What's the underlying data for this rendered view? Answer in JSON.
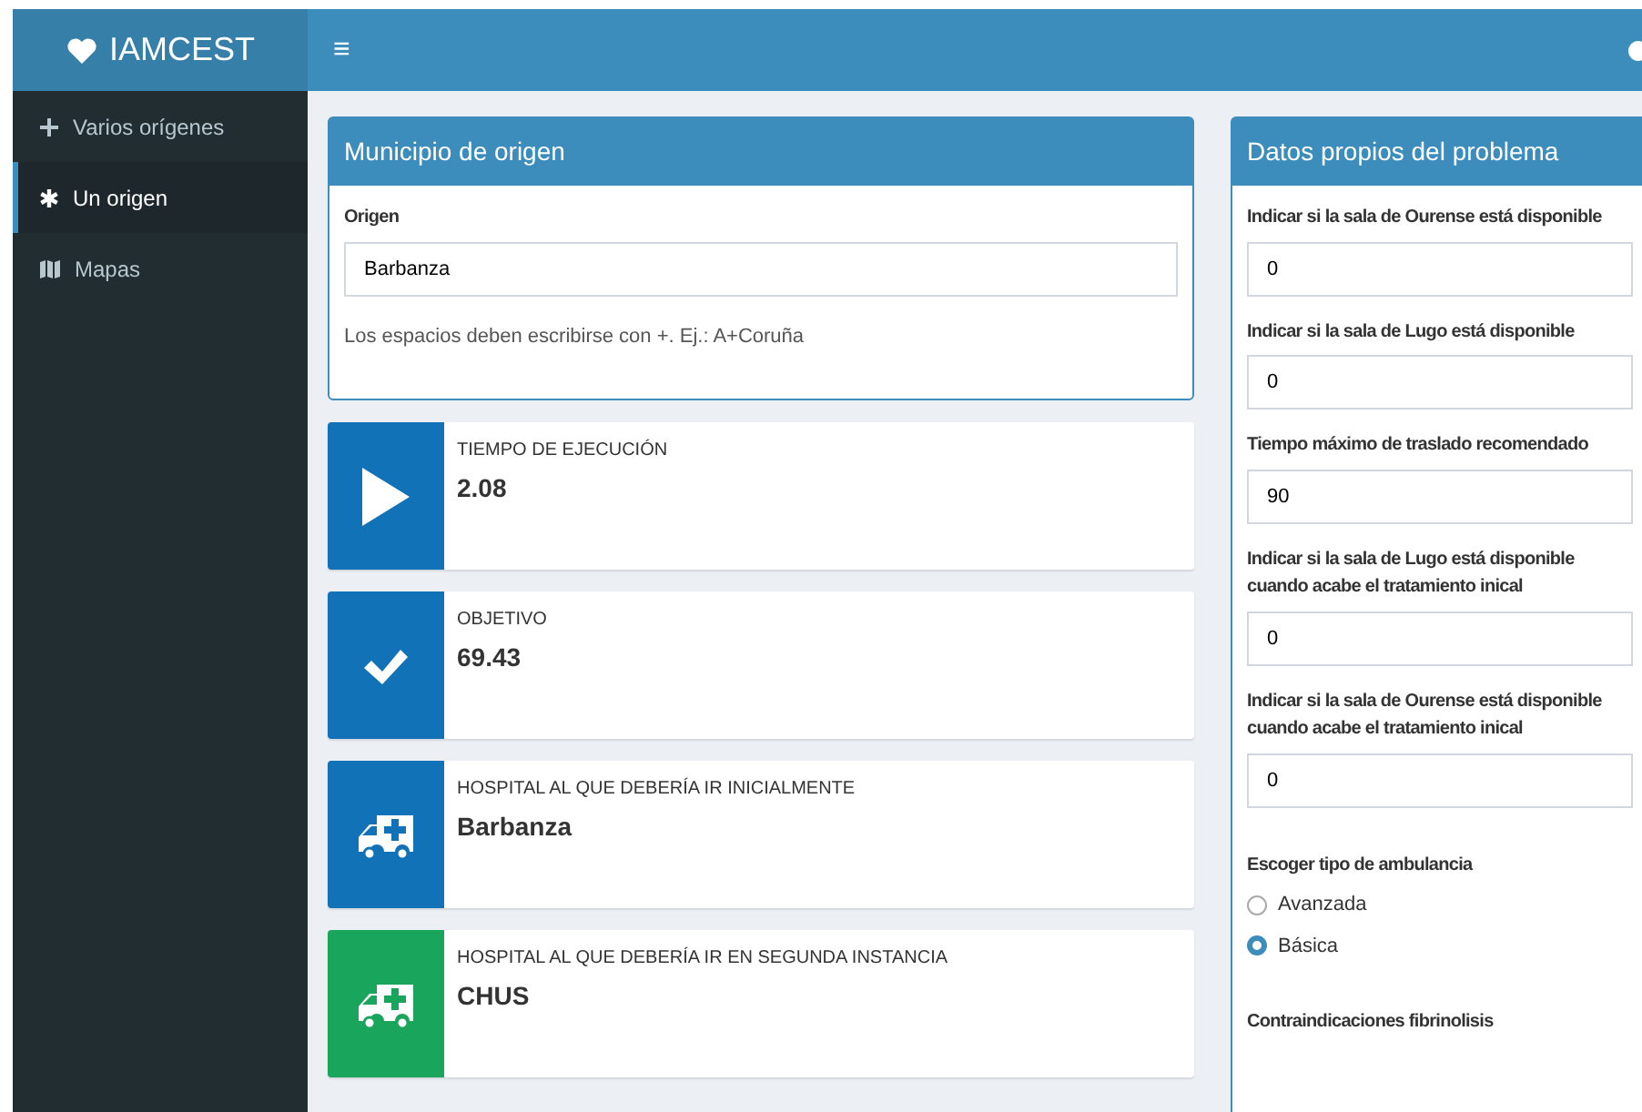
{
  "logo": {
    "text": "IAMCEST"
  },
  "header": {
    "menu_toggle": "≡"
  },
  "sidebar": {
    "items": [
      {
        "label": "Varios orígenes",
        "kind": "plus",
        "selected": false
      },
      {
        "label": "Un origen",
        "kind": "asterisk",
        "selected": true
      },
      {
        "label": "Mapas",
        "kind": "map",
        "selected": false
      }
    ]
  },
  "origin_box": {
    "title": "Municipio de origen",
    "field_label": "Origen",
    "value": "Barbanza",
    "help": "Los espacios deben escribirse con +. Ej.: A+Coruña"
  },
  "info_boxes": [
    {
      "kind": "play",
      "color": "#1172b8",
      "label": "TIEMPO DE EJECUCIÓN",
      "value": "2.08"
    },
    {
      "kind": "check",
      "color": "#1172b8",
      "label": "OBJETIVO",
      "value": "69.43"
    },
    {
      "kind": "ambulance",
      "color": "#1172b8",
      "label": "HOSPITAL AL QUE DEBERÍA IR INICIALMENTE",
      "value": "Barbanza"
    },
    {
      "kind": "ambulance",
      "color": "#1aa55c",
      "label": "HOSPITAL AL QUE DEBERÍA IR EN SEGUNDA INSTANCIA",
      "value": "CHUS"
    }
  ],
  "problem_box": {
    "title": "Datos propios del problema",
    "fields": [
      {
        "label": "Indicar si la sala de Ourense está disponible",
        "value": "0"
      },
      {
        "label": "Indicar si la sala de Lugo está disponible",
        "value": "0"
      },
      {
        "label": "Tiempo máximo de traslado recomendado",
        "value": "90"
      },
      {
        "label": "Indicar si la sala de Lugo está disponible cuando acabe el tratamiento inical",
        "value": "0"
      },
      {
        "label": "Indicar si la sala de Ourense está disponible cuando acabe el tratamiento inical",
        "value": "0"
      }
    ],
    "ambulance_label": "Escoger tipo de ambulancia",
    "ambulance_options": [
      {
        "label": "Avanzada",
        "selected": false
      },
      {
        "label": "Básica",
        "selected": true
      }
    ],
    "contraindications_label": "Contraindicaciones fibrinolisis"
  }
}
